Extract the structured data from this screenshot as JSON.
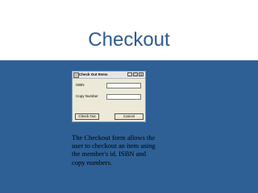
{
  "slide": {
    "title": "Checkout",
    "caption": "The Checkout form allows the user to checkout an item using the member's id, ISBN and copy numbers."
  },
  "dialog": {
    "title": "Check Out Items",
    "controls": {
      "minimize": "_",
      "maximize": "□",
      "close": "X"
    },
    "fields": [
      {
        "label": "ISBN",
        "value": ""
      },
      {
        "label": "Copy Number",
        "value": ""
      }
    ],
    "buttons": {
      "checkout": "Check Out",
      "cancel": "Cancel"
    }
  },
  "colors": {
    "background": "#2e6096",
    "title_band": "#ffffff",
    "title_text": "#2e5a8f",
    "dialog_face": "#ece9d8"
  }
}
